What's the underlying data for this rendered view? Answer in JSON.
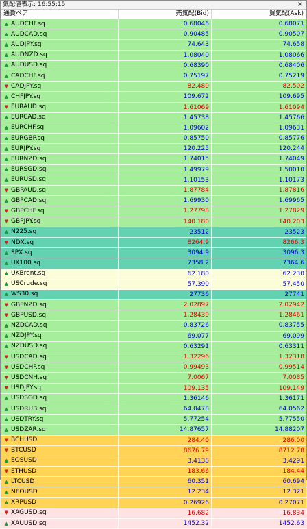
{
  "window": {
    "title": "気配値表示: 16:55:15",
    "close_glyph": "×"
  },
  "columns": {
    "symbol": "通貨ペア",
    "bid": "売気配(Bid)",
    "ask": "買気配(Ask)"
  },
  "colors": {
    "green": "#a7ee9c",
    "teal": "#63d2b0",
    "cream": "#fafdd8",
    "orange": "#ffd356",
    "pink": "#ffe3e3",
    "bid_up": "#0000d8",
    "bid_down": "#e00000"
  },
  "rows": [
    {
      "symbol": "AUDCHF.sq",
      "bid": "0.68046",
      "ask": "0.68071",
      "dir": "up",
      "group": "green"
    },
    {
      "symbol": "AUDCAD.sq",
      "bid": "0.90485",
      "ask": "0.90507",
      "dir": "up",
      "group": "green"
    },
    {
      "symbol": "AUDJPY.sq",
      "bid": "74.643",
      "ask": "74.658",
      "dir": "up",
      "group": "green"
    },
    {
      "symbol": "AUDNZD.sq",
      "bid": "1.08040",
      "ask": "1.08066",
      "dir": "up",
      "group": "green"
    },
    {
      "symbol": "AUDUSD.sq",
      "bid": "0.68390",
      "ask": "0.68406",
      "dir": "up",
      "group": "green"
    },
    {
      "symbol": "CADCHF.sq",
      "bid": "0.75197",
      "ask": "0.75219",
      "dir": "up",
      "group": "green"
    },
    {
      "symbol": "CADJPY.sq",
      "bid": "82.480",
      "ask": "82.502",
      "dir": "down",
      "group": "green"
    },
    {
      "symbol": "CHFJPY.sq",
      "bid": "109.672",
      "ask": "109.695",
      "dir": "up",
      "group": "green"
    },
    {
      "symbol": "EURAUD.sq",
      "bid": "1.61069",
      "ask": "1.61094",
      "dir": "down",
      "group": "green"
    },
    {
      "symbol": "EURCAD.sq",
      "bid": "1.45738",
      "ask": "1.45766",
      "dir": "up",
      "group": "green"
    },
    {
      "symbol": "EURCHF.sq",
      "bid": "1.09602",
      "ask": "1.09631",
      "dir": "up",
      "group": "green"
    },
    {
      "symbol": "EURGBP.sq",
      "bid": "0.85750",
      "ask": "0.85776",
      "dir": "up",
      "group": "green"
    },
    {
      "symbol": "EURJPY.sq",
      "bid": "120.225",
      "ask": "120.244",
      "dir": "up",
      "group": "green"
    },
    {
      "symbol": "EURNZD.sq",
      "bid": "1.74015",
      "ask": "1.74049",
      "dir": "up",
      "group": "green"
    },
    {
      "symbol": "EURSGD.sq",
      "bid": "1.49979",
      "ask": "1.50010",
      "dir": "up",
      "group": "green"
    },
    {
      "symbol": "EURUSD.sq",
      "bid": "1.10153",
      "ask": "1.10173",
      "dir": "up",
      "group": "green"
    },
    {
      "symbol": "GBPAUD.sq",
      "bid": "1.87784",
      "ask": "1.87816",
      "dir": "down",
      "group": "green"
    },
    {
      "symbol": "GBPCAD.sq",
      "bid": "1.69930",
      "ask": "1.69965",
      "dir": "up",
      "group": "green"
    },
    {
      "symbol": "GBPCHF.sq",
      "bid": "1.27798",
      "ask": "1.27829",
      "dir": "down",
      "group": "green"
    },
    {
      "symbol": "GBPJPY.sq",
      "bid": "140.180",
      "ask": "140.203",
      "dir": "down",
      "group": "green"
    },
    {
      "symbol": "N225.sq",
      "bid": "23512",
      "ask": "23523",
      "dir": "up",
      "group": "teal"
    },
    {
      "symbol": "NDX.sq",
      "bid": "8264.9",
      "ask": "8266.3",
      "dir": "down",
      "group": "teal"
    },
    {
      "symbol": "SPX.sq",
      "bid": "3094.9",
      "ask": "3096.3",
      "dir": "up",
      "group": "teal"
    },
    {
      "symbol": "UK100.sq",
      "bid": "7358.2",
      "ask": "7364.6",
      "dir": "up",
      "group": "teal"
    },
    {
      "symbol": "UKBrent.sq",
      "bid": "62.180",
      "ask": "62.230",
      "dir": "up",
      "group": "cream"
    },
    {
      "symbol": "USCrude.sq",
      "bid": "57.390",
      "ask": "57.450",
      "dir": "up",
      "group": "cream"
    },
    {
      "symbol": "WS30.sq",
      "bid": "27736",
      "ask": "27741",
      "dir": "up",
      "group": "teal"
    },
    {
      "symbol": "GBPNZD.sq",
      "bid": "2.02897",
      "ask": "2.02942",
      "dir": "down",
      "group": "green"
    },
    {
      "symbol": "GBPUSD.sq",
      "bid": "1.28439",
      "ask": "1.28461",
      "dir": "down",
      "group": "green"
    },
    {
      "symbol": "NZDCAD.sq",
      "bid": "0.83726",
      "ask": "0.83755",
      "dir": "up",
      "group": "green"
    },
    {
      "symbol": "NZDJPY.sq",
      "bid": "69.077",
      "ask": "69.099",
      "dir": "up",
      "group": "green"
    },
    {
      "symbol": "NZDUSD.sq",
      "bid": "0.63291",
      "ask": "0.63311",
      "dir": "up",
      "group": "green"
    },
    {
      "symbol": "USDCAD.sq",
      "bid": "1.32296",
      "ask": "1.32318",
      "dir": "down",
      "group": "green"
    },
    {
      "symbol": "USDCHF.sq",
      "bid": "0.99493",
      "ask": "0.99514",
      "dir": "down",
      "group": "green"
    },
    {
      "symbol": "USDCNH.sq",
      "bid": "7.0067",
      "ask": "7.0085",
      "dir": "down",
      "group": "green"
    },
    {
      "symbol": "USDJPY.sq",
      "bid": "109.135",
      "ask": "109.149",
      "dir": "down",
      "group": "green"
    },
    {
      "symbol": "USDSGD.sq",
      "bid": "1.36146",
      "ask": "1.36171",
      "dir": "up",
      "group": "green"
    },
    {
      "symbol": "USDRUB.sq",
      "bid": "64.0478",
      "ask": "64.0562",
      "dir": "up",
      "group": "green"
    },
    {
      "symbol": "USDTRY.sq",
      "bid": "5.77254",
      "ask": "5.77550",
      "dir": "up",
      "group": "green"
    },
    {
      "symbol": "USDZAR.sq",
      "bid": "14.87657",
      "ask": "14.88207",
      "dir": "up",
      "group": "green"
    },
    {
      "symbol": "BCHUSD",
      "bid": "284.40",
      "ask": "286.00",
      "dir": "down",
      "group": "orange"
    },
    {
      "symbol": "BTCUSD",
      "bid": "8676.79",
      "ask": "8712.78",
      "dir": "down",
      "group": "orange"
    },
    {
      "symbol": "EOSUSD",
      "bid": "3.4138",
      "ask": "3.4291",
      "dir": "up",
      "group": "orange"
    },
    {
      "symbol": "ETHUSD",
      "bid": "183.66",
      "ask": "184.44",
      "dir": "down",
      "group": "orange"
    },
    {
      "symbol": "LTCUSD",
      "bid": "60.351",
      "ask": "60.694",
      "dir": "up",
      "group": "orange"
    },
    {
      "symbol": "NEOUSD",
      "bid": "12.234",
      "ask": "12.321",
      "dir": "up",
      "group": "orange"
    },
    {
      "symbol": "XRPUSD",
      "bid": "0.26926",
      "ask": "0.27071",
      "dir": "up",
      "group": "orange"
    },
    {
      "symbol": "XAGUSD.sq",
      "bid": "16.682",
      "ask": "16.834",
      "dir": "down",
      "group": "pink"
    },
    {
      "symbol": "XAUUSD.sq",
      "bid": "1452.32",
      "ask": "1452.63",
      "dir": "up",
      "group": "pink"
    }
  ]
}
